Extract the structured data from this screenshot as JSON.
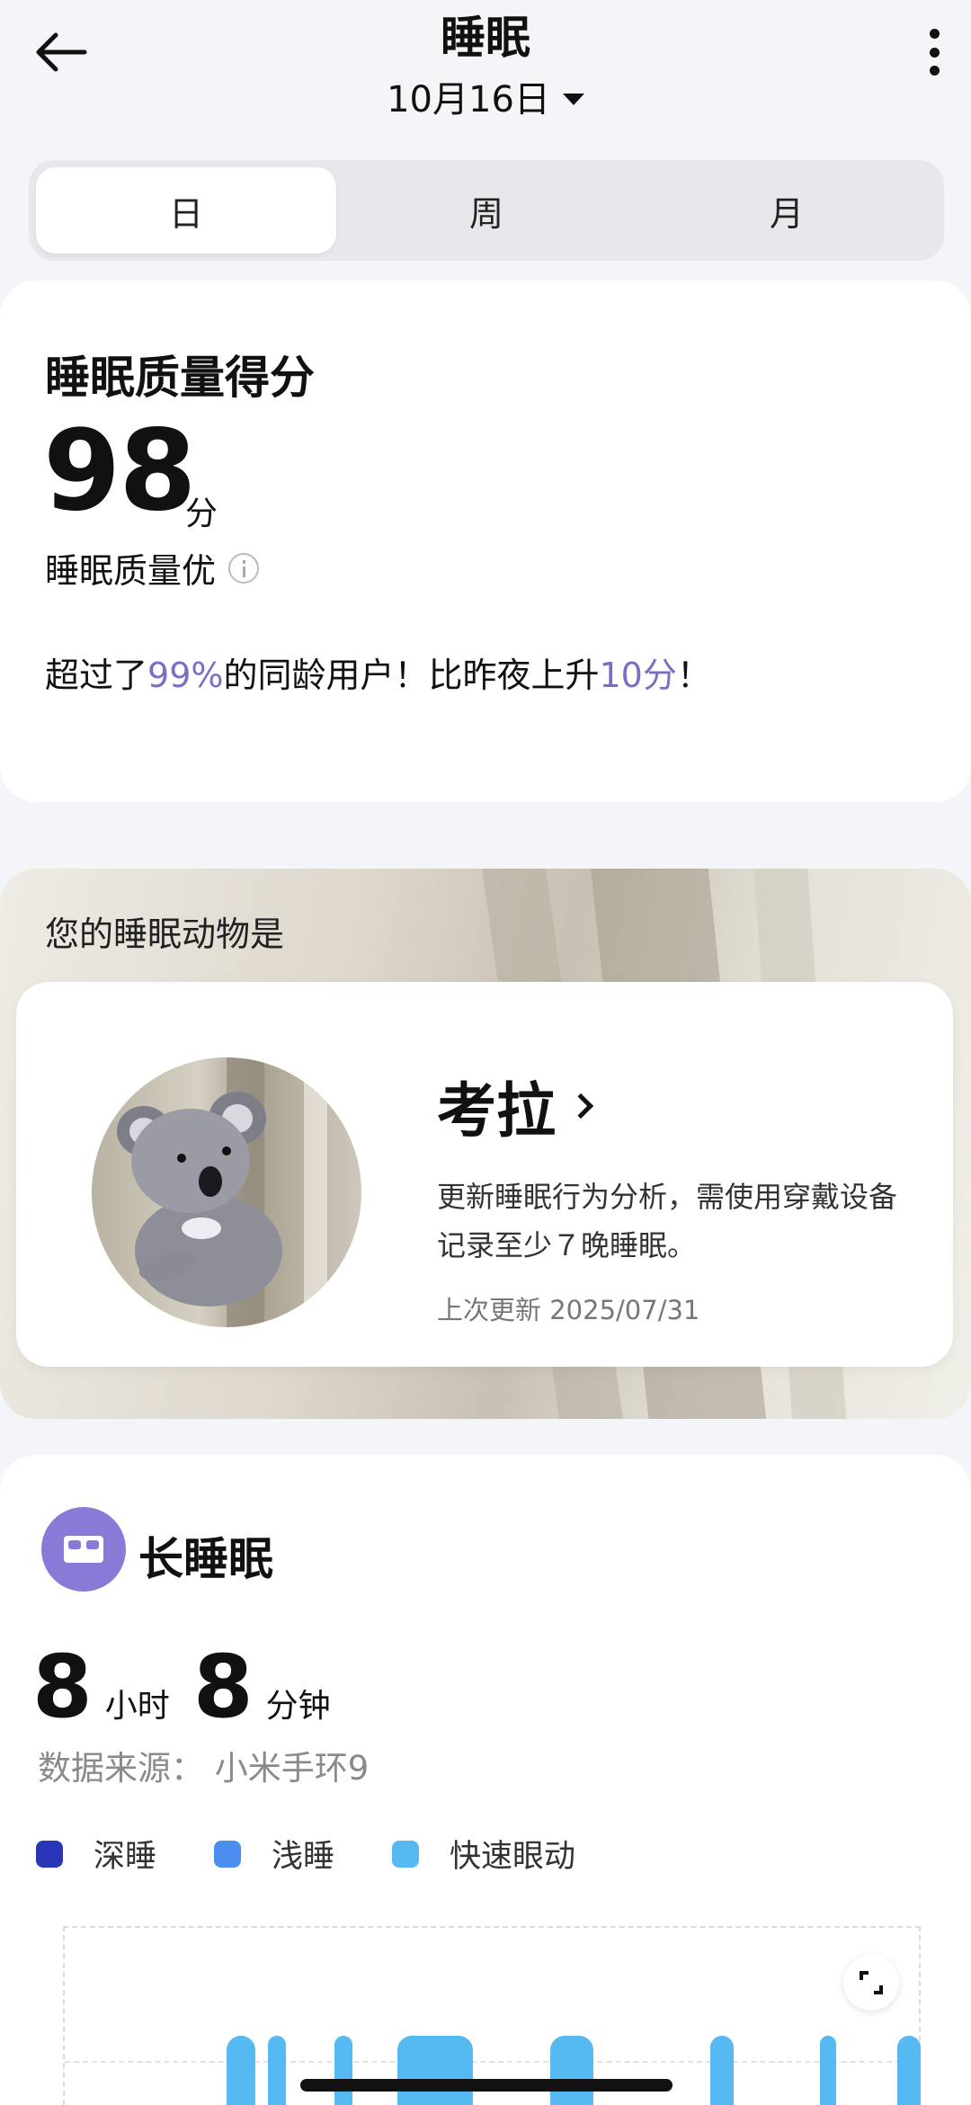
{
  "header": {
    "title": "睡眠",
    "date": "10月16日",
    "back_icon": "arrow-left-icon",
    "more_icon": "more-vertical-icon"
  },
  "tabs": [
    {
      "label": "日",
      "active": true
    },
    {
      "label": "周",
      "active": false
    },
    {
      "label": "月",
      "active": false
    }
  ],
  "score": {
    "heading": "睡眠质量得分",
    "value": "98",
    "unit": "分",
    "level": "睡眠质量优",
    "compare_prefix": "超过了",
    "percentile": "99%",
    "compare_middle": "的同龄用户！比昨夜上升",
    "increase": "10分",
    "compare_suffix": "！",
    "accent_color": "#7b6fc4"
  },
  "animal": {
    "label": "您的睡眠动物是",
    "name": "考拉",
    "description": "更新睡眠行为分析，需使用穿戴设备记录至少７晚睡眠。",
    "updated": "上次更新 2025/07/31"
  },
  "long_sleep": {
    "title": "长睡眠",
    "hours": "8",
    "hours_unit": "小时",
    "minutes": "8",
    "minutes_unit": "分钟",
    "source": "数据来源：  小米手环9",
    "icon_color": "#8a7ad8",
    "legend": [
      {
        "label": "深睡",
        "color": "#2936b8"
      },
      {
        "label": "浅睡",
        "color": "#4a8ef0"
      },
      {
        "label": "快速眼动",
        "color": "#56b9f2"
      }
    ]
  }
}
